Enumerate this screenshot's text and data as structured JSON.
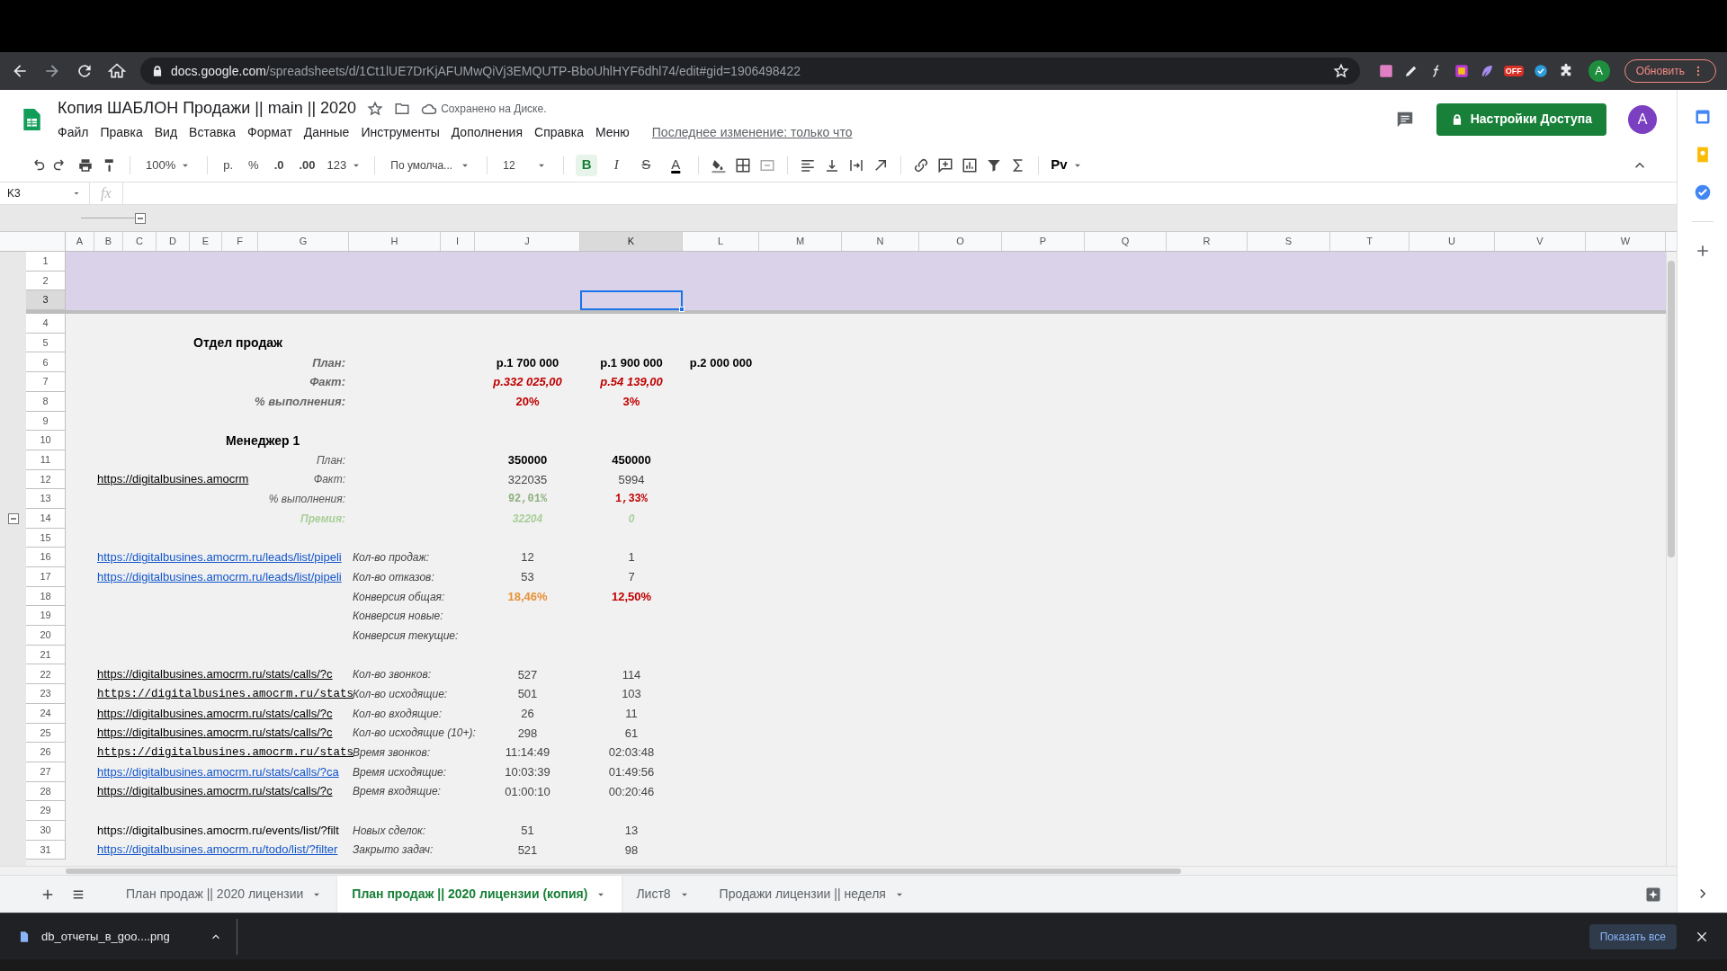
{
  "browser": {
    "url_host": "docs.google.com",
    "url_path": "/spreadsheets/d/1Ct1lUE7DrKjAFUMwQiVj3EMQUTP-BboUhlHYF6dhl74/edit#gid=1906498422",
    "extension_badge": "OFF",
    "profile": "A",
    "update_button": "Обновить"
  },
  "doc": {
    "title": "Копия ШАБЛОН Продажи || main || 2020",
    "save_status": "Сохранено на Диске.",
    "menu": [
      "Файл",
      "Правка",
      "Вид",
      "Вставка",
      "Формат",
      "Данные",
      "Инструменты",
      "Дополнения",
      "Справка",
      "Меню"
    ],
    "last_edit": "Последнее изменение: только что",
    "share_button": "Настройки Доступа",
    "avatar": "A"
  },
  "toolbar": {
    "zoom": "100%",
    "currency": "р.",
    "percent": "%",
    "decrease_decimals": ".0",
    "increase_decimals": ".00",
    "more_formats": "123",
    "font": "По умолча...",
    "font_size": "12",
    "format_buttons": [
      {
        "label": "B",
        "kind": "bold",
        "selected": true
      },
      {
        "label": "I",
        "kind": "italic",
        "selected": false
      },
      {
        "label": "S",
        "kind": "strike",
        "selected": false
      },
      {
        "label": "A",
        "kind": "color",
        "selected": false
      }
    ],
    "addon": "Pv"
  },
  "formula_bar": {
    "name_box": "K3",
    "fx": "fx"
  },
  "sheet": {
    "columns": [
      {
        "letter": "A",
        "selected": false
      },
      {
        "letter": "B",
        "selected": false
      },
      {
        "letter": "C",
        "selected": false
      },
      {
        "letter": "D",
        "selected": false
      },
      {
        "letter": "E",
        "selected": false
      },
      {
        "letter": "F",
        "selected": false
      },
      {
        "letter": "G",
        "selected": false
      },
      {
        "letter": "H",
        "selected": false
      },
      {
        "letter": "I",
        "selected": false
      },
      {
        "letter": "J",
        "selected": false
      },
      {
        "letter": "K",
        "selected": true
      },
      {
        "letter": "L",
        "selected": false
      },
      {
        "letter": "M",
        "selected": false
      },
      {
        "letter": "N",
        "selected": false
      },
      {
        "letter": "O",
        "selected": false
      },
      {
        "letter": "P",
        "selected": false
      },
      {
        "letter": "Q",
        "selected": false
      },
      {
        "letter": "R",
        "selected": false
      },
      {
        "letter": "S",
        "selected": false
      },
      {
        "letter": "T",
        "selected": false
      },
      {
        "letter": "U",
        "selected": false
      },
      {
        "letter": "V",
        "selected": false
      },
      {
        "letter": "W",
        "selected": false
      }
    ],
    "rows": [
      {
        "number": "1",
        "kind": "band",
        "selected": false,
        "toggle": false
      },
      {
        "number": "2",
        "kind": "band",
        "selected": false,
        "toggle": false
      },
      {
        "number": "3",
        "kind": "band",
        "selected": true,
        "toggle": false
      },
      {
        "number": "4",
        "kind": "blank",
        "selected": false,
        "toggle": false
      },
      {
        "number": "5",
        "kind": "section",
        "heading": "Отдел продаж",
        "selected": false,
        "toggle": false
      },
      {
        "number": "6",
        "kind": "summary",
        "label": "План:",
        "values": [
          {
            "text": "р.1 700 000",
            "kind": "strong"
          },
          {
            "text": "р.1 900 000",
            "kind": "strong"
          },
          {
            "text": "р.2 000 000",
            "kind": "strong"
          }
        ],
        "selected": false,
        "toggle": false
      },
      {
        "number": "7",
        "kind": "summary",
        "label": "Факт:",
        "values": [
          {
            "text": "р.332 025,00",
            "kind": "alert_italic"
          },
          {
            "text": "р.54 139,00",
            "kind": "alert_italic"
          }
        ],
        "selected": false,
        "toggle": false
      },
      {
        "number": "8",
        "kind": "summary",
        "label": "% выполнения:",
        "values": [
          {
            "text": "20%",
            "kind": "alert"
          },
          {
            "text": "3%",
            "kind": "alert"
          }
        ],
        "selected": false,
        "toggle": false
      },
      {
        "number": "9",
        "kind": "blank",
        "selected": false,
        "toggle": false
      },
      {
        "number": "10",
        "kind": "manager",
        "heading": "Менеджер 1",
        "selected": false,
        "toggle": false
      },
      {
        "number": "11",
        "kind": "metric",
        "label": "План:",
        "values": [
          {
            "text": "350000",
            "kind": "strong"
          },
          {
            "text": "450000",
            "kind": "strong"
          }
        ],
        "selected": false,
        "toggle": false
      },
      {
        "number": "12",
        "kind": "metric",
        "link": {
          "text": "https://digitalbusines.amocrm",
          "kind": "plain_link"
        },
        "label": "Факт:",
        "values": [
          {
            "text": "322035",
            "kind": "plain"
          },
          {
            "text": "5994",
            "kind": "plain"
          }
        ],
        "selected": false,
        "toggle": false
      },
      {
        "number": "13",
        "kind": "metric",
        "label": "% выполнения:",
        "values": [
          {
            "text": "92,01%",
            "kind": "good_mono"
          },
          {
            "text": "1,33%",
            "kind": "alert_mono"
          }
        ],
        "selected": false,
        "toggle": false
      },
      {
        "number": "14",
        "kind": "bonus",
        "label": "Премия:",
        "values": [
          {
            "text": "32204",
            "kind": "faded"
          },
          {
            "text": "0",
            "kind": "faded"
          }
        ],
        "selected": false,
        "toggle": true
      },
      {
        "number": "15",
        "kind": "blank",
        "selected": false,
        "toggle": false
      },
      {
        "number": "16",
        "kind": "stat",
        "link": {
          "text": "https://digitalbusines.amocrm.ru/leads/list/pipeli",
          "kind": "link"
        },
        "label": "Кол-во продаж:",
        "values": [
          {
            "text": "12",
            "kind": "plain"
          },
          {
            "text": "1",
            "kind": "plain"
          }
        ],
        "selected": false,
        "toggle": false
      },
      {
        "number": "17",
        "kind": "stat",
        "link": {
          "text": "https://digitalbusines.amocrm.ru/leads/list/pipeli",
          "kind": "link"
        },
        "label": "Кол-во отказов:",
        "values": [
          {
            "text": "53",
            "kind": "plain"
          },
          {
            "text": "7",
            "kind": "plain"
          }
        ],
        "selected": false,
        "toggle": false
      },
      {
        "number": "18",
        "kind": "stat",
        "label": "Конверсия общая:",
        "values": [
          {
            "text": "18,46%",
            "kind": "warn"
          },
          {
            "text": "12,50%",
            "kind": "alert"
          }
        ],
        "selected": false,
        "toggle": false
      },
      {
        "number": "19",
        "kind": "stat",
        "label": "Конверсия новые:",
        "selected": false,
        "toggle": false
      },
      {
        "number": "20",
        "kind": "stat",
        "label": "Конверсия текущие:",
        "selected": false,
        "toggle": false
      },
      {
        "number": "21",
        "kind": "blank",
        "selected": false,
        "toggle": false
      },
      {
        "number": "22",
        "kind": "stat",
        "link": {
          "text": "https://digitalbusines.amocrm.ru/stats/calls/?c",
          "kind": "plain_link"
        },
        "label": "Кол-во звонков:",
        "values": [
          {
            "text": "527",
            "kind": "plain"
          },
          {
            "text": "114",
            "kind": "plain"
          }
        ],
        "selected": false,
        "toggle": false
      },
      {
        "number": "23",
        "kind": "stat",
        "link": {
          "text": "https://digitalbusines.amocrm.ru/stats",
          "kind": "code_link"
        },
        "label": "Кол-во исходящие:",
        "values": [
          {
            "text": "501",
            "kind": "plain"
          },
          {
            "text": "103",
            "kind": "plain"
          }
        ],
        "selected": false,
        "toggle": false
      },
      {
        "number": "24",
        "kind": "stat",
        "link": {
          "text": "https://digitalbusines.amocrm.ru/stats/calls/?c",
          "kind": "plain_link"
        },
        "label": "Кол-во входящие:",
        "values": [
          {
            "text": "26",
            "kind": "plain"
          },
          {
            "text": "11",
            "kind": "plain"
          }
        ],
        "selected": false,
        "toggle": false
      },
      {
        "number": "25",
        "kind": "stat",
        "link": {
          "text": "https://digitalbusines.amocrm.ru/stats/calls/?c",
          "kind": "plain_link"
        },
        "label": "Кол-во исходящие (10+):",
        "values": [
          {
            "text": "298",
            "kind": "plain"
          },
          {
            "text": "61",
            "kind": "plain"
          }
        ],
        "selected": false,
        "toggle": false
      },
      {
        "number": "26",
        "kind": "stat",
        "link": {
          "text": "https://digitalbusines.amocrm.ru/stats",
          "kind": "code_link"
        },
        "label": "Время звонков:",
        "values": [
          {
            "text": "11:14:49",
            "kind": "plain"
          },
          {
            "text": "02:03:48",
            "kind": "plain"
          }
        ],
        "selected": false,
        "toggle": false
      },
      {
        "number": "27",
        "kind": "stat",
        "link": {
          "text": "https://digitalbusines.amocrm.ru/stats/calls/?ca",
          "kind": "link"
        },
        "label": "Время исходящие:",
        "values": [
          {
            "text": "10:03:39",
            "kind": "plain"
          },
          {
            "text": "01:49:56",
            "kind": "plain"
          }
        ],
        "selected": false,
        "toggle": false
      },
      {
        "number": "28",
        "kind": "stat",
        "link": {
          "text": "https://digitalbusines.amocrm.ru/stats/calls/?c",
          "kind": "plain_link"
        },
        "label": "Время входящие:",
        "values": [
          {
            "text": "01:00:10",
            "kind": "plain"
          },
          {
            "text": "00:20:46",
            "kind": "plain"
          }
        ],
        "selected": false,
        "toggle": false
      },
      {
        "number": "29",
        "kind": "blank",
        "selected": false,
        "toggle": false
      },
      {
        "number": "30",
        "kind": "stat",
        "link": {
          "text": "https://digitalbusines.amocrm.ru/events/list/?filt",
          "kind": "text"
        },
        "label": "Новых сделок:",
        "values": [
          {
            "text": "51",
            "kind": "plain"
          },
          {
            "text": "13",
            "kind": "plain"
          }
        ],
        "selected": false,
        "toggle": false
      },
      {
        "number": "31",
        "kind": "stat",
        "link": {
          "text": "https://digitalbusines.amocrm.ru/todo/list/?filter",
          "kind": "link"
        },
        "label": "Закрыто задач:",
        "values": [
          {
            "text": "521",
            "kind": "plain"
          },
          {
            "text": "98",
            "kind": "plain"
          }
        ],
        "selected": false,
        "toggle": false
      }
    ]
  },
  "tabs": [
    {
      "label": "План продаж || 2020 лицензии",
      "selected": false
    },
    {
      "label": "План продаж || 2020 лицензии (копия)",
      "selected": true
    },
    {
      "label": "Лист8",
      "selected": false
    },
    {
      "label": "Продажи лицензии || неделя",
      "selected": false
    }
  ],
  "download": {
    "file": "db_отчеты_в_goo....png",
    "show_all": "Показать все"
  }
}
